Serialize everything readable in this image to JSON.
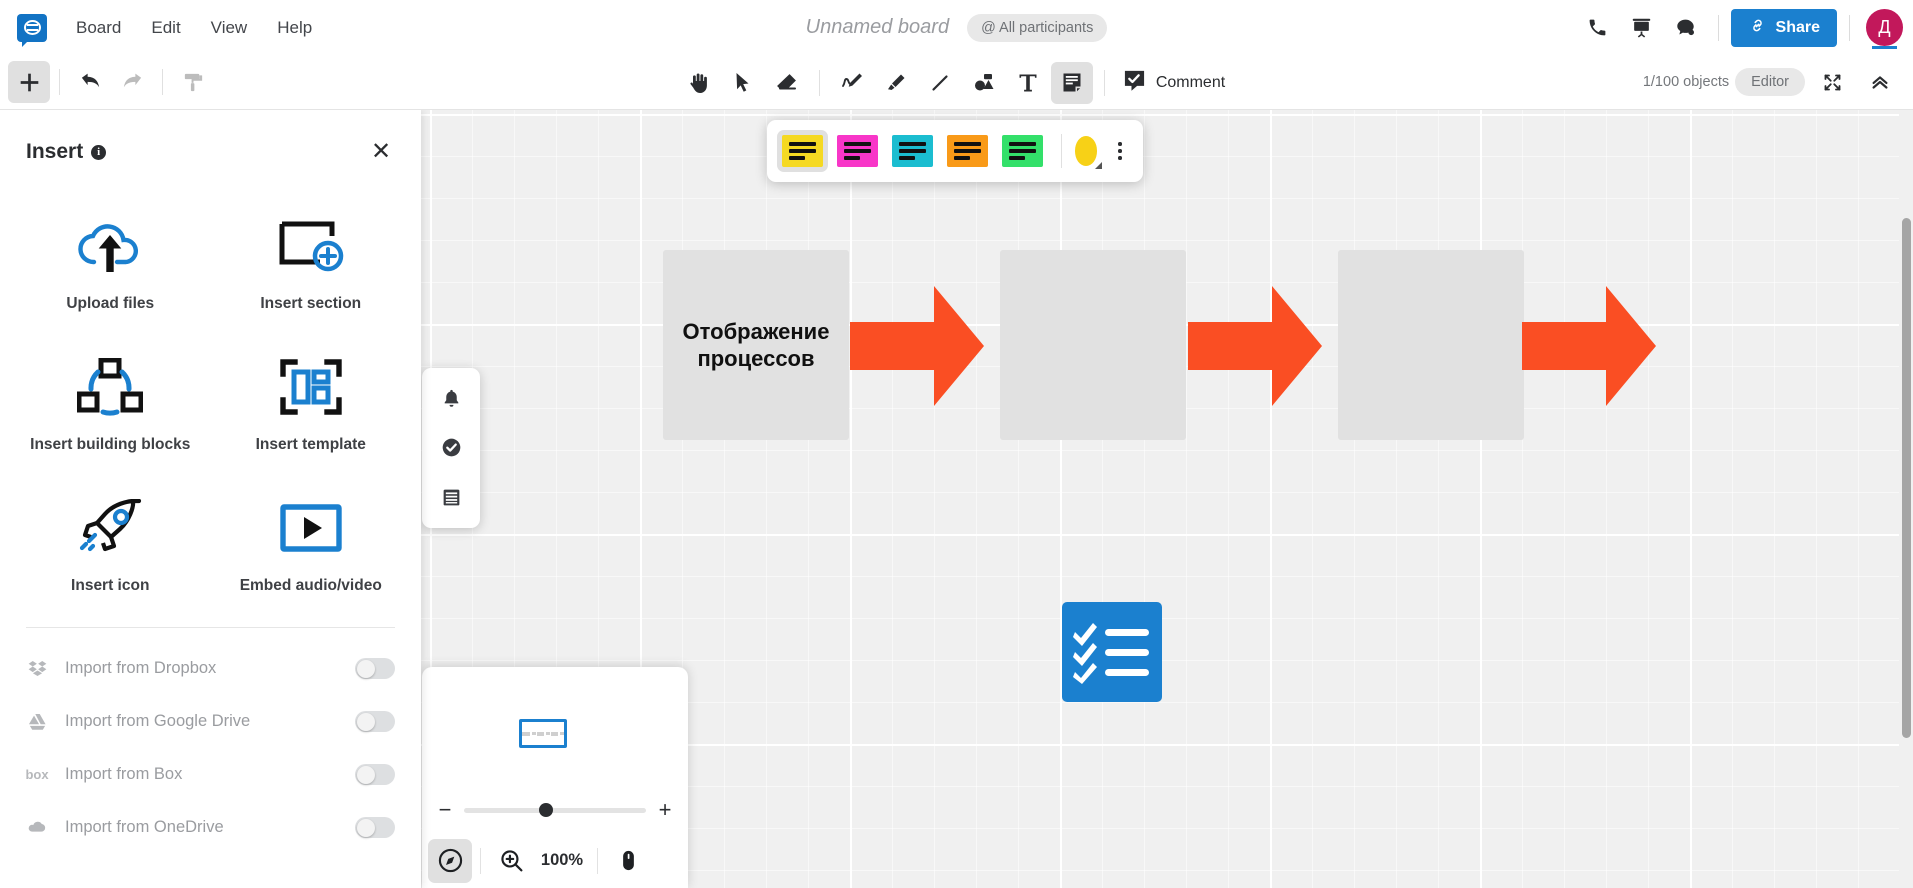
{
  "menubar": {
    "logo": "app-logo",
    "items": [
      {
        "label": "Board"
      },
      {
        "label": "Edit"
      },
      {
        "label": "View"
      },
      {
        "label": "Help"
      }
    ],
    "board_title": "Unnamed board",
    "participants_pill": "@ All participants",
    "right_icons": [
      {
        "name": "phone-icon"
      },
      {
        "name": "presentation-icon"
      },
      {
        "name": "chat-icon"
      }
    ],
    "share_label": "Share",
    "avatar_initial": "Д"
  },
  "toolbar": {
    "left": [
      {
        "name": "add-button",
        "state": "active"
      },
      {
        "name": "undo-button",
        "state": "enabled"
      },
      {
        "name": "redo-button",
        "state": "disabled"
      },
      {
        "name": "format-painter-button",
        "state": "disabled"
      }
    ],
    "tools": [
      {
        "name": "hand-tool"
      },
      {
        "name": "select-tool"
      },
      {
        "name": "eraser-tool"
      },
      {
        "name": "pen-tool"
      },
      {
        "name": "marker-tool"
      },
      {
        "name": "line-tool"
      },
      {
        "name": "shapes-tool"
      },
      {
        "name": "text-tool"
      },
      {
        "name": "sticky-note-tool"
      }
    ],
    "comment_label": "Comment",
    "object_count": "1/100 objects",
    "role_pill": "Editor",
    "right_icons": [
      {
        "name": "fullscreen-icon"
      },
      {
        "name": "collapse-icon"
      }
    ]
  },
  "palette": {
    "swatches": [
      {
        "color": "#f5d922",
        "selected": true
      },
      {
        "color": "#f836c8",
        "selected": false
      },
      {
        "color": "#1bbdd0",
        "selected": false
      },
      {
        "color": "#f99a18",
        "selected": false
      },
      {
        "color": "#33e06a",
        "selected": false
      }
    ],
    "active_color": "#f7d117"
  },
  "side_menu": {
    "items": [
      {
        "name": "notifications-icon"
      },
      {
        "name": "tasks-icon"
      },
      {
        "name": "outline-icon"
      }
    ]
  },
  "insert_panel": {
    "title": "Insert",
    "close_label": "✕",
    "tiles": [
      {
        "label": "Upload files",
        "icon": "cloud-upload-icon"
      },
      {
        "label": "Insert section",
        "icon": "section-icon"
      },
      {
        "label": "Insert building blocks",
        "icon": "building-blocks-icon"
      },
      {
        "label": "Insert template",
        "icon": "template-icon"
      },
      {
        "label": "Insert icon",
        "icon": "rocket-icon"
      },
      {
        "label": "Embed audio/video",
        "icon": "play-icon"
      }
    ],
    "imports": [
      {
        "label": "Import from Dropbox",
        "icon": "dropbox-icon",
        "enabled": false
      },
      {
        "label": "Import from Google Drive",
        "icon": "google-drive-icon",
        "enabled": false
      },
      {
        "label": "Import from Box",
        "icon": "box-icon",
        "enabled": false
      },
      {
        "label": "Import from OneDrive",
        "icon": "onedrive-icon",
        "enabled": false
      }
    ]
  },
  "canvas": {
    "shapes": [
      {
        "text": "Отображение процессов",
        "color": "#e1e1e1"
      },
      {
        "text": "",
        "color": "#e1e1e1"
      },
      {
        "text": "",
        "color": "#e1e1e1"
      }
    ],
    "arrow_color": "#fa4e23",
    "checklist_color": "#1b80cf"
  },
  "zoom_panel": {
    "zoom_level": "100%",
    "minus_label": "−",
    "plus_label": "+",
    "buttons": [
      {
        "name": "navigator-icon",
        "active": true
      },
      {
        "name": "zoom-icon",
        "active": false
      },
      {
        "name": "mouse-mode-icon",
        "active": false
      }
    ]
  }
}
